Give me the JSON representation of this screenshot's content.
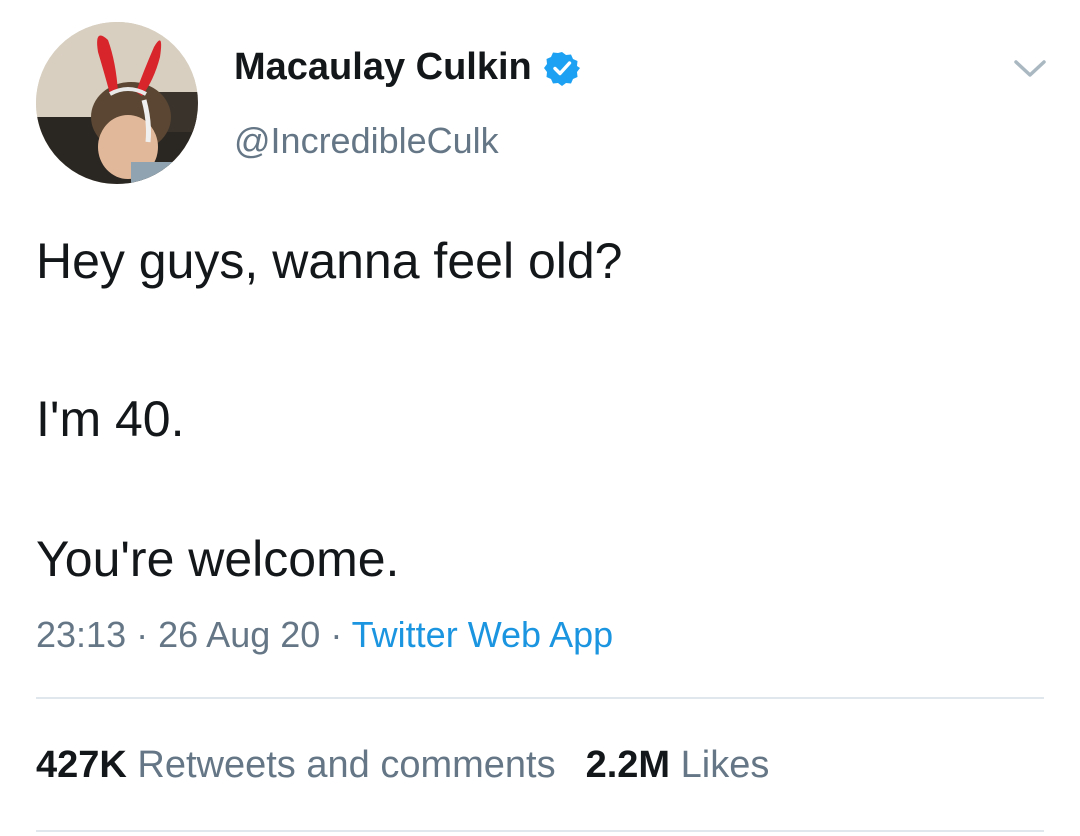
{
  "author": {
    "display_name": "Macaulay Culkin",
    "handle": "@IncredibleCulk",
    "verified": true,
    "avatar_icon": "profile-photo-bunny-ears"
  },
  "tweet": {
    "lines": [
      "Hey guys, wanna feel old?",
      "I'm 40.",
      "You're welcome."
    ]
  },
  "meta": {
    "time": "23:13",
    "separator": "·",
    "date": "26 Aug 20",
    "source": "Twitter Web App"
  },
  "stats": {
    "retweets_count": "427K",
    "retweets_label": "Retweets and comments",
    "likes_count": "2.2M",
    "likes_label": "Likes"
  },
  "colors": {
    "text": "#14171a",
    "secondary": "#657786",
    "link": "#1b95e0",
    "verified": "#1da1f2",
    "divider": "#e1e8ed"
  }
}
